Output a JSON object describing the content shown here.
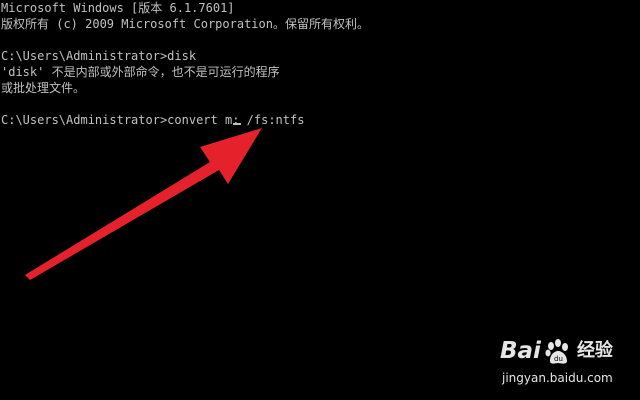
{
  "console": {
    "line1": "Microsoft Windows [版本 6.1.7601]",
    "line2": "版权所有 (c) 2009 Microsoft Corporation。保留所有权利。",
    "line3": "",
    "line4": "C:\\Users\\Administrator>disk",
    "line5": "'disk' 不是内部或外部命令，也不是可运行的程序",
    "line6": "或批处理文件。",
    "line7": "",
    "prompt": "C:\\Users\\Administrator>",
    "command_before_cursor": "convert m",
    "command_after_cursor": ": /fs:ntfs"
  },
  "colors": {
    "background": "#000000",
    "text": "#c0c0c0",
    "arrow": "#e5222b"
  },
  "watermark": {
    "brand_left": "Bai",
    "brand_right": "du",
    "product": "经验",
    "url": "jingyan.baidu.com"
  }
}
